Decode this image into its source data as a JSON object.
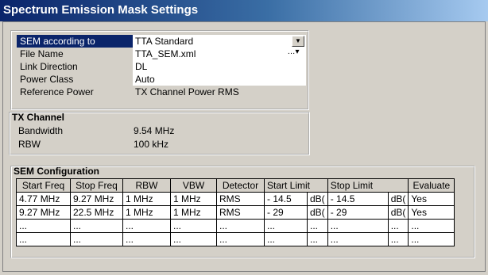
{
  "window": {
    "title": "Spectrum Emission Mask Settings"
  },
  "settings": {
    "sem_label": "SEM according to",
    "sem_value": "TTA Standard",
    "file_label": "File Name",
    "file_value": "TTA_SEM.xml",
    "link_label": "Link Direction",
    "link_value": "DL",
    "power_label": "Power Class",
    "power_value": "Auto",
    "ref_label": "Reference Power",
    "ref_value": "TX Channel Power RMS"
  },
  "tx_channel": {
    "title": "TX Channel",
    "bw_label": "Bandwidth",
    "bw_value": "9.54 MHz",
    "rbw_label": "RBW",
    "rbw_value": "100 kHz"
  },
  "sem_config": {
    "title": "SEM Configuration",
    "headers": [
      "Start Freq",
      "Stop Freq",
      "RBW",
      "VBW",
      "Detector",
      "Start Limit",
      "",
      "Stop Limit",
      "",
      "Evaluate"
    ],
    "rows": [
      [
        "4.77 MHz",
        "9.27 MHz",
        "1 MHz",
        "1 MHz",
        "RMS",
        "- 14.5",
        "dB(",
        "- 14.5",
        "dB(",
        "Yes"
      ],
      [
        "9.27 MHz",
        "22.5 MHz",
        "1 MHz",
        "1 MHz",
        "RMS",
        "- 29",
        "dB(",
        "- 29",
        "dB(",
        "Yes"
      ],
      [
        "...",
        "...",
        "...",
        "...",
        "...",
        "...",
        "...",
        "...",
        "...",
        "..."
      ],
      [
        "...",
        "...",
        "...",
        "...",
        "...",
        "...",
        "...",
        "...",
        "...",
        "..."
      ]
    ]
  },
  "icons": {
    "dropdown": "chevron-down-icon",
    "file_browse": "file-browse-icon"
  }
}
